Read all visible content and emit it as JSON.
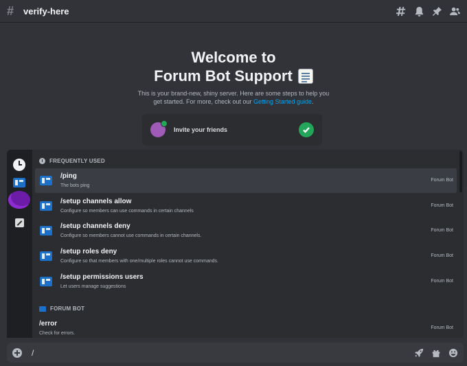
{
  "header": {
    "hash": "#",
    "channel": "verify-here",
    "icons": [
      "threads-icon",
      "bell-icon",
      "pin-icon",
      "members-icon"
    ]
  },
  "welcome": {
    "title_line1": "Welcome to",
    "title_line2": "Forum Bot Support",
    "desc_line1": "This is your brand-new, shiny server. Here are some steps to help you",
    "desc_line2_prefix": "get started. For more, check out our ",
    "desc_link": "Getting Started guide",
    "desc_suffix": "."
  },
  "invite": {
    "label": "Invite your friends"
  },
  "popup": {
    "section_frequent": "FREQUENTLY USED",
    "section_bot": "FORUM BOT",
    "commands": [
      {
        "name": "/ping",
        "desc": "The bots ping",
        "source": "Forum Bot"
      },
      {
        "name": "/setup channels allow",
        "desc": "Configure so members can use commands in certain channels",
        "source": "Forum Bot"
      },
      {
        "name": "/setup channels deny",
        "desc": "Configure so members cannot use commands in certain channels.",
        "source": "Forum Bot"
      },
      {
        "name": "/setup roles deny",
        "desc": "Configure so that members with one/multiple roles cannot use commands.",
        "source": "Forum Bot"
      },
      {
        "name": "/setup permissions users",
        "desc": "Let users manage suggestions",
        "source": "Forum Bot"
      }
    ],
    "bot_commands": [
      {
        "name": "/error",
        "desc": "Check for errors.",
        "source": "Forum Bot"
      }
    ]
  },
  "composer": {
    "value": "/"
  }
}
